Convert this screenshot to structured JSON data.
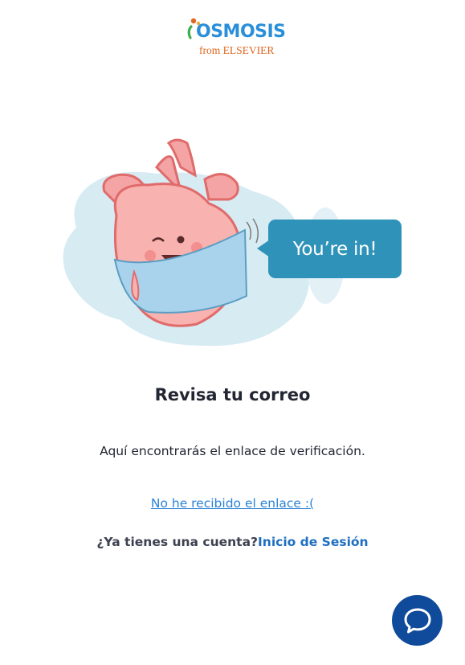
{
  "logo": {
    "name": "OSMOSIS",
    "subtitle": "from ELSEVIER"
  },
  "illustration": {
    "icon": "heart-mascot-illustration",
    "speech_bubble": "You’re in!"
  },
  "content": {
    "title": "Revisa tu correo",
    "description": "Aquí encontrarás el enlace de verificación.",
    "resend_link": "No he recibido el enlace :(",
    "login_question": "¿Ya tienes una cuenta?",
    "login_link": "Inicio de Sesión"
  },
  "chat": {
    "icon": "chat-bubble-icon"
  },
  "colors": {
    "brand_blue": "#2a8fd8",
    "brand_orange": "#e0671f",
    "bubble": "#2f93b9",
    "link": "#2a83d6",
    "login_link": "#1f6fc0",
    "chat_button": "#104a9a"
  }
}
